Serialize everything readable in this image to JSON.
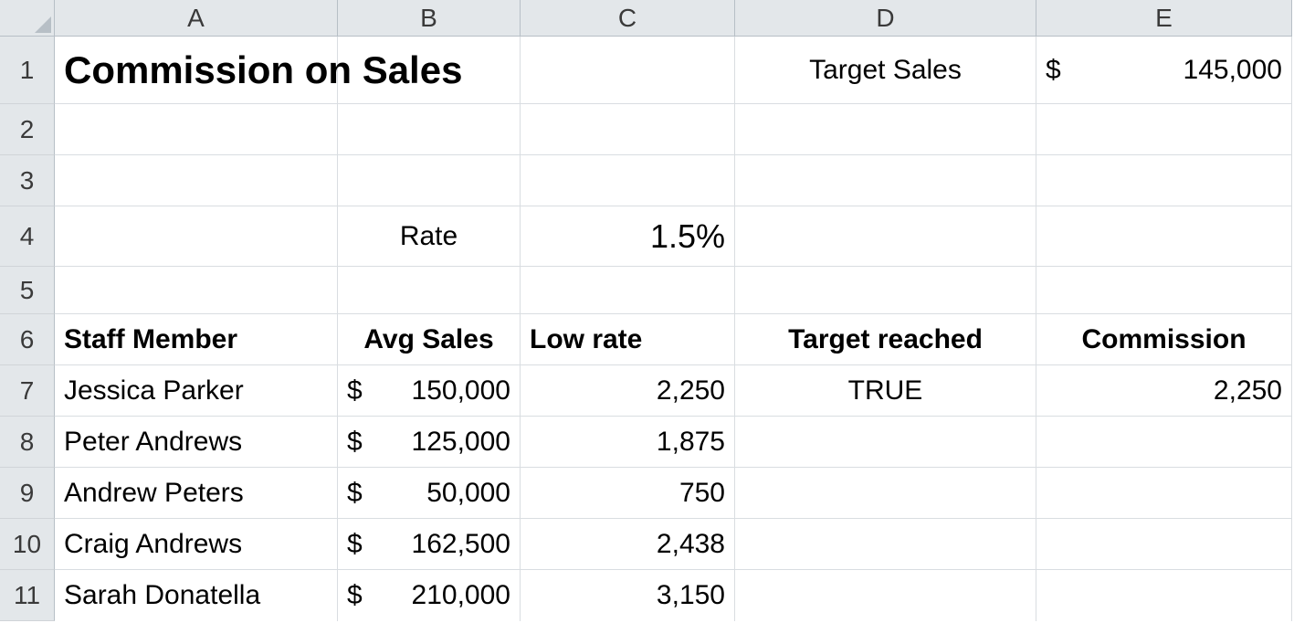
{
  "columns": [
    "A",
    "B",
    "C",
    "D",
    "E"
  ],
  "rows": [
    "1",
    "2",
    "3",
    "4",
    "5",
    "6",
    "7",
    "8",
    "9",
    "10",
    "11"
  ],
  "title": "Commission on Sales",
  "target_sales_label": "Target Sales",
  "target_sales_sym": "$",
  "target_sales_value": "145,000",
  "rate_label": "Rate",
  "rate_value": "1.5%",
  "headers": {
    "staff": "Staff Member",
    "avg": "Avg Sales",
    "low": "Low rate",
    "target": "Target reached",
    "comm": "Commission"
  },
  "staff": [
    {
      "name": "Jessica Parker",
      "sym": "$",
      "avg": "150,000",
      "low": "2,250",
      "target": "TRUE",
      "comm": "2,250"
    },
    {
      "name": "Peter Andrews",
      "sym": "$",
      "avg": "125,000",
      "low": "1,875",
      "target": "",
      "comm": ""
    },
    {
      "name": "Andrew Peters",
      "sym": "$",
      "avg": "50,000",
      "low": "750",
      "target": "",
      "comm": ""
    },
    {
      "name": "Craig Andrews",
      "sym": "$",
      "avg": "162,500",
      "low": "2,438",
      "target": "",
      "comm": ""
    },
    {
      "name": "Sarah Donatella",
      "sym": "$",
      "avg": "210,000",
      "low": "3,150",
      "target": "",
      "comm": ""
    }
  ]
}
